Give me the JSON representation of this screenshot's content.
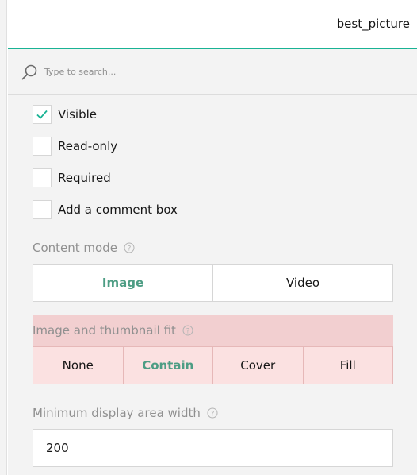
{
  "header": {
    "title": "best_picture"
  },
  "search": {
    "placeholder": "Type to search..."
  },
  "checkboxes": [
    {
      "label": "Visible",
      "checked": true
    },
    {
      "label": "Read-only",
      "checked": false
    },
    {
      "label": "Required",
      "checked": false
    },
    {
      "label": "Add a comment box",
      "checked": false
    }
  ],
  "content_mode": {
    "title": "Content mode",
    "options": [
      "Image",
      "Video"
    ],
    "selected": "Image"
  },
  "image_fit": {
    "title": "Image and thumbnail fit",
    "options": [
      "None",
      "Contain",
      "Cover",
      "Fill"
    ],
    "selected": "Contain"
  },
  "min_width": {
    "title": "Minimum display area width",
    "value": "200"
  },
  "colors": {
    "accent": "#19b394",
    "selected_text": "#4d9d84",
    "error_band": "#f2cfd0",
    "error_fill": "#fbe1e1"
  }
}
